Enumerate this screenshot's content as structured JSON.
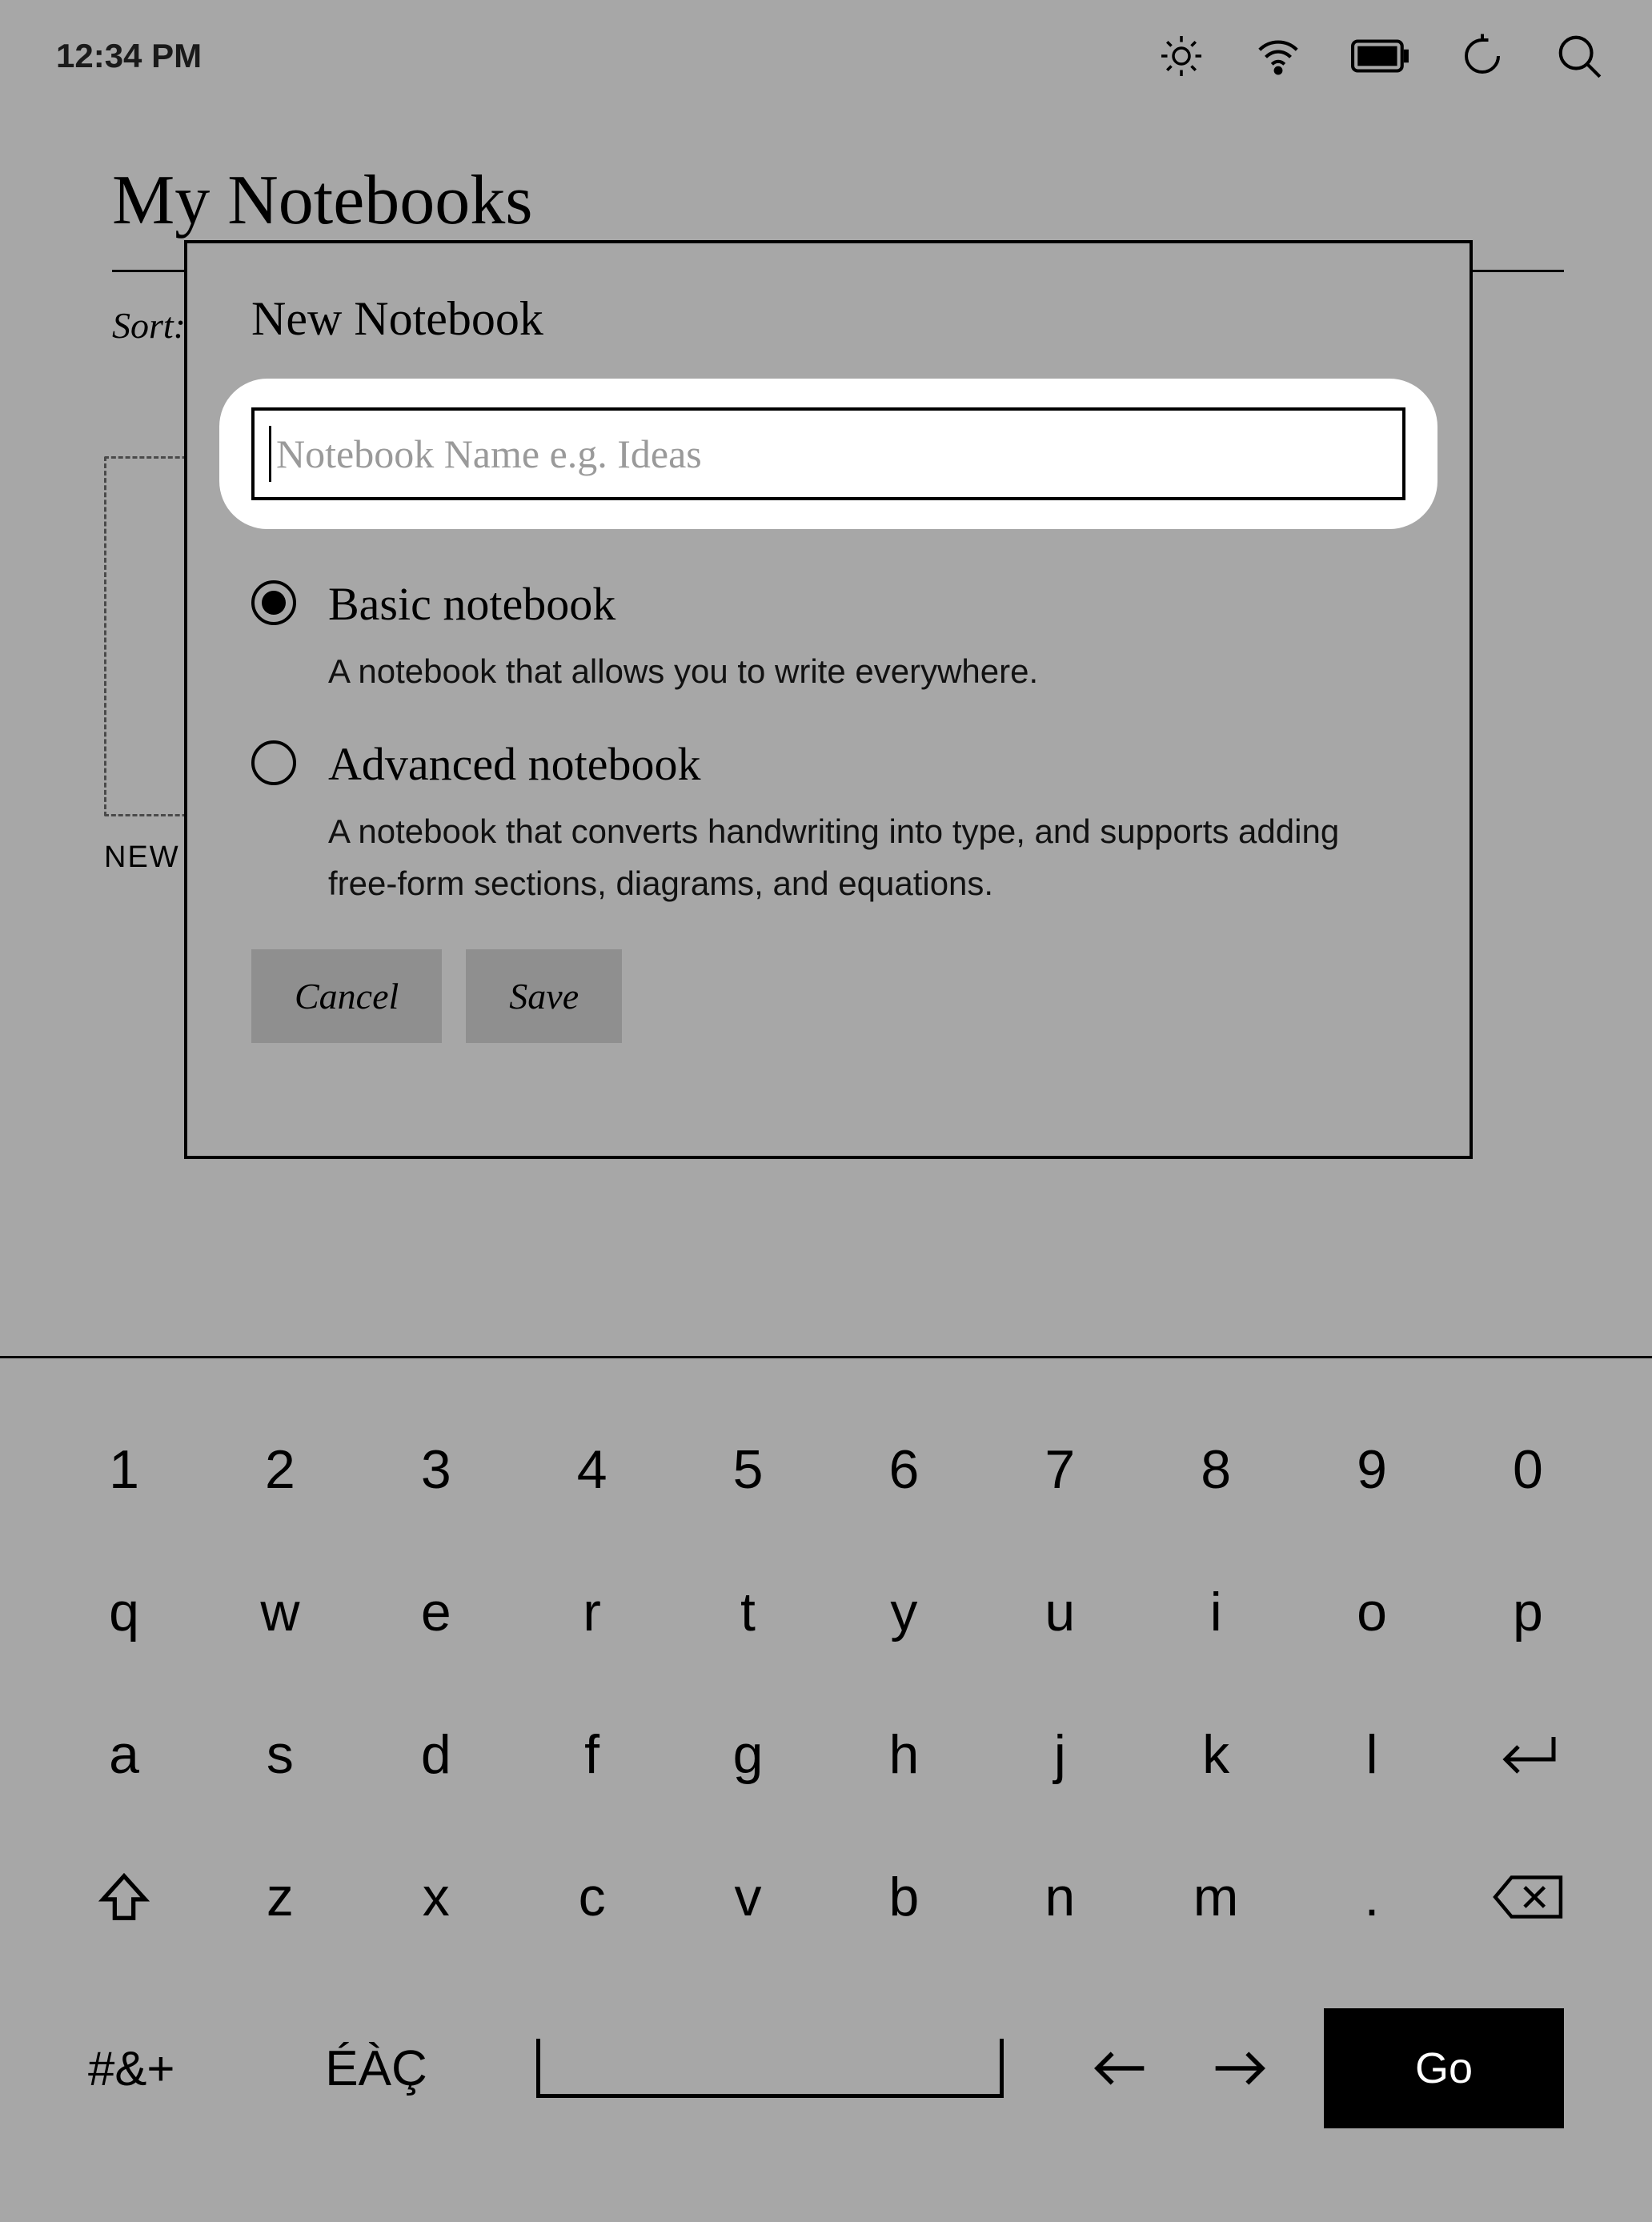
{
  "status": {
    "time": "12:34 PM",
    "icons": {
      "brightness": "brightness-icon",
      "wifi": "wifi-icon",
      "battery": "battery-icon",
      "sync": "sync-icon",
      "search": "search-icon"
    }
  },
  "page": {
    "title": "My Notebooks",
    "sort_label": "Sort:"
  },
  "new_tile": {
    "label": "NEW"
  },
  "dialog": {
    "title": "New Notebook",
    "name_placeholder": "Notebook Name e.g. Ideas",
    "name_value": "",
    "options": [
      {
        "id": "basic",
        "title": "Basic notebook",
        "desc": "A notebook that allows you to write everywhere.",
        "selected": true
      },
      {
        "id": "advanced",
        "title": "Advanced notebook",
        "desc": "A notebook that converts handwriting into type, and supports adding free-form sections, diagrams, and equations.",
        "selected": false
      }
    ],
    "cancel_label": "Cancel",
    "save_label": "Save"
  },
  "keyboard": {
    "row1": [
      "1",
      "2",
      "3",
      "4",
      "5",
      "6",
      "7",
      "8",
      "9",
      "0"
    ],
    "row2": [
      "q",
      "w",
      "e",
      "r",
      "t",
      "y",
      "u",
      "i",
      "o",
      "p"
    ],
    "row3": [
      "a",
      "s",
      "d",
      "f",
      "g",
      "h",
      "j",
      "k",
      "l"
    ],
    "row4_letters": [
      "z",
      "x",
      "c",
      "v",
      "b",
      "n",
      "m",
      "."
    ],
    "symbols_label": "#&+",
    "accents_label": "ÉÀÇ",
    "go_label": "Go"
  }
}
